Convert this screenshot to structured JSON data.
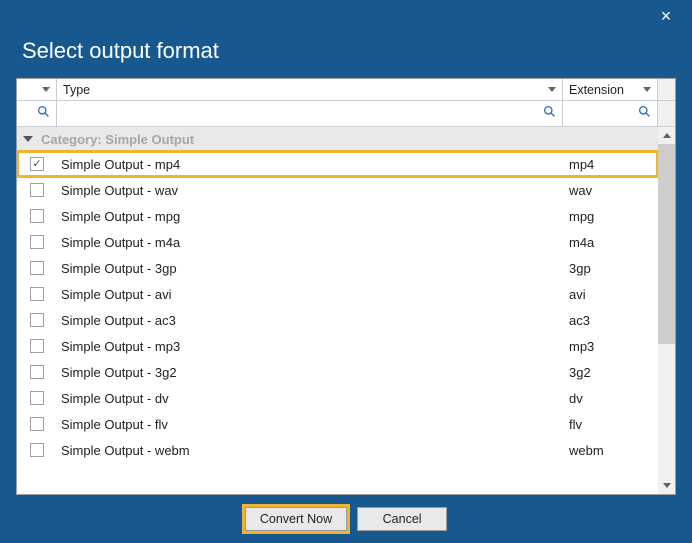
{
  "dialog": {
    "title": "Select output format"
  },
  "columns": {
    "type": "Type",
    "extension": "Extension"
  },
  "category": {
    "label": "Category:  Simple Output"
  },
  "rows": [
    {
      "type": "Simple Output - mp4",
      "ext": "mp4",
      "checked": true,
      "selected": true
    },
    {
      "type": "Simple Output - wav",
      "ext": "wav",
      "checked": false,
      "selected": false
    },
    {
      "type": "Simple Output - mpg",
      "ext": "mpg",
      "checked": false,
      "selected": false
    },
    {
      "type": "Simple Output - m4a",
      "ext": "m4a",
      "checked": false,
      "selected": false
    },
    {
      "type": "Simple Output - 3gp",
      "ext": "3gp",
      "checked": false,
      "selected": false
    },
    {
      "type": "Simple Output - avi",
      "ext": "avi",
      "checked": false,
      "selected": false
    },
    {
      "type": "Simple Output - ac3",
      "ext": "ac3",
      "checked": false,
      "selected": false
    },
    {
      "type": "Simple Output - mp3",
      "ext": "mp3",
      "checked": false,
      "selected": false
    },
    {
      "type": "Simple Output - 3g2",
      "ext": "3g2",
      "checked": false,
      "selected": false
    },
    {
      "type": "Simple Output - dv",
      "ext": "dv",
      "checked": false,
      "selected": false
    },
    {
      "type": "Simple Output - flv",
      "ext": "flv",
      "checked": false,
      "selected": false
    },
    {
      "type": "Simple Output - webm",
      "ext": "webm",
      "checked": false,
      "selected": false
    }
  ],
  "buttons": {
    "convert": "Convert Now",
    "cancel": "Cancel"
  }
}
